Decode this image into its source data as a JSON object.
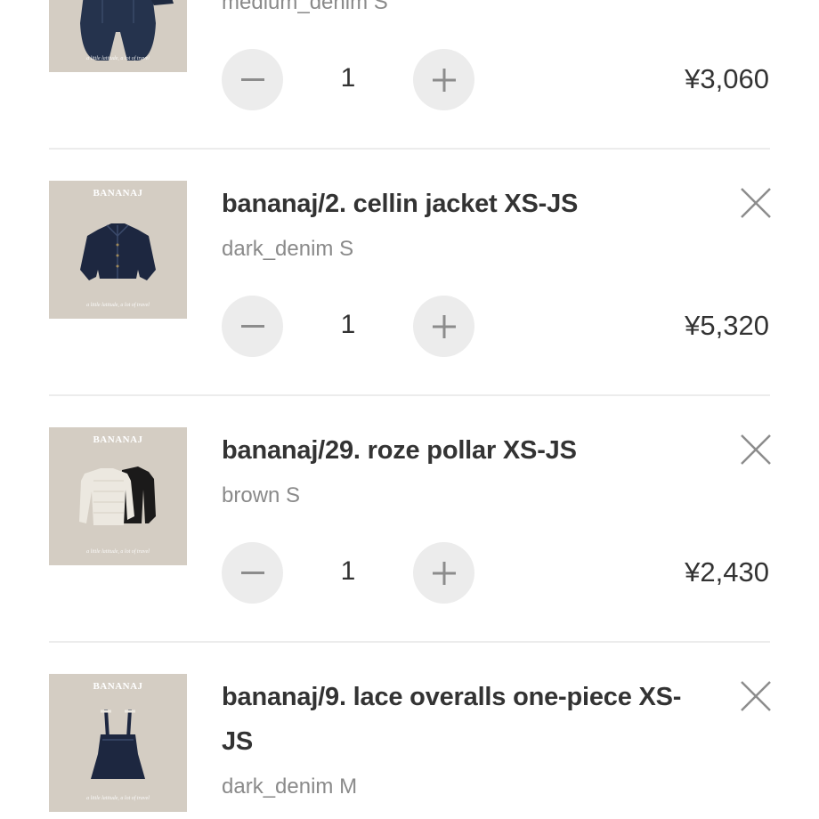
{
  "cart": {
    "items": [
      {
        "title": "",
        "variant": "medium_denim S",
        "brand": "",
        "caption": "a little latitude, a lot of travel",
        "quantity": "1",
        "price": "¥3,060",
        "thumb_icon": "denim-shorts-icon"
      },
      {
        "title": "bananaj/2. cellin jacket XS-JS",
        "variant": "dark_denim S",
        "brand": "BANANAJ",
        "caption": "a little latitude, a lot of travel",
        "quantity": "1",
        "price": "¥5,320",
        "thumb_icon": "denim-jacket-icon"
      },
      {
        "title": "bananaj/29. roze pollar XS-JS",
        "variant": "brown S",
        "brand": "BANANAJ",
        "caption": "a little latitude, a lot of travel",
        "quantity": "1",
        "price": "¥2,430",
        "thumb_icon": "knit-tops-icon"
      },
      {
        "title": "bananaj/9. lace overalls one-piece XS-JS",
        "variant": "dark_denim M",
        "brand": "BANANAJ",
        "caption": "a little latitude, a lot of travel",
        "quantity": "",
        "price": "",
        "thumb_icon": "overall-dress-icon"
      }
    ]
  },
  "icons": {
    "decrement": "minus-icon",
    "increment": "plus-icon",
    "remove": "close-icon"
  },
  "colors": {
    "button_bg": "#ececec",
    "icon": "#8c8c8c",
    "text": "#333333",
    "muted": "#8a8a8a",
    "thumb_bg": "#d4cdc3"
  }
}
